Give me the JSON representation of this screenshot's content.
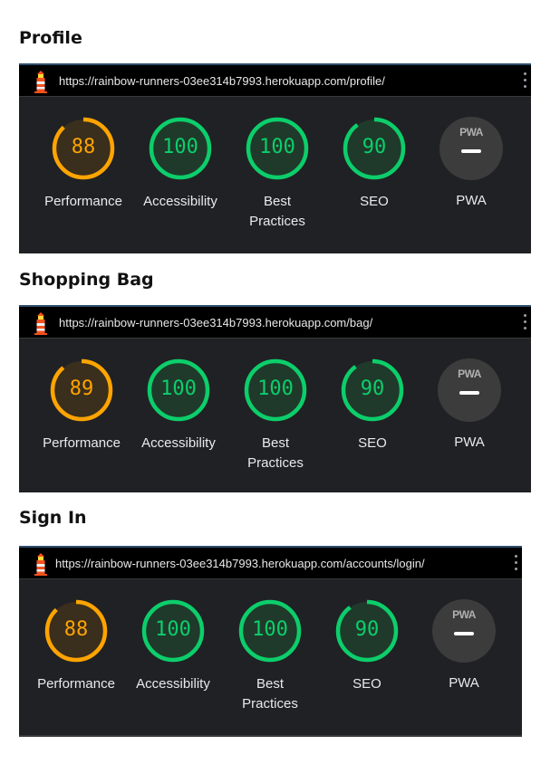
{
  "colors": {
    "orange": "#ffa400",
    "green": "#0cce6b",
    "orange_bg": "#3a2e1c",
    "green_bg": "#1f3a2a",
    "panel": "#202124"
  },
  "reports": [
    {
      "heading": "Profile",
      "url": "https://rainbow-runners-03ee314b7993.herokuapp.com/profile/",
      "metrics": [
        {
          "score": "88",
          "label": "Performance",
          "value": 88
        },
        {
          "score": "100",
          "label": "Accessibility",
          "value": 100
        },
        {
          "score": "100",
          "label": "Best\nPractices",
          "value": 100
        },
        {
          "score": "90",
          "label": "SEO",
          "value": 90
        }
      ],
      "pwa": {
        "badge": "PWA",
        "label": "PWA"
      }
    },
    {
      "heading": "Shopping Bag",
      "url": "https://rainbow-runners-03ee314b7993.herokuapp.com/bag/",
      "metrics": [
        {
          "score": "89",
          "label": "Performance",
          "value": 89
        },
        {
          "score": "100",
          "label": "Accessibility",
          "value": 100
        },
        {
          "score": "100",
          "label": "Best\nPractices",
          "value": 100
        },
        {
          "score": "90",
          "label": "SEO",
          "value": 90
        }
      ],
      "pwa": {
        "badge": "PWA",
        "label": "PWA"
      }
    },
    {
      "heading": "Sign In",
      "url": "https://rainbow-runners-03ee314b7993.herokuapp.com/accounts/login/",
      "metrics": [
        {
          "score": "88",
          "label": "Performance",
          "value": 88
        },
        {
          "score": "100",
          "label": "Accessibility",
          "value": 100
        },
        {
          "score": "100",
          "label": "Best\nPractices",
          "value": 100
        },
        {
          "score": "90",
          "label": "SEO",
          "value": 90
        }
      ],
      "pwa": {
        "badge": "PWA",
        "label": "PWA"
      }
    }
  ]
}
